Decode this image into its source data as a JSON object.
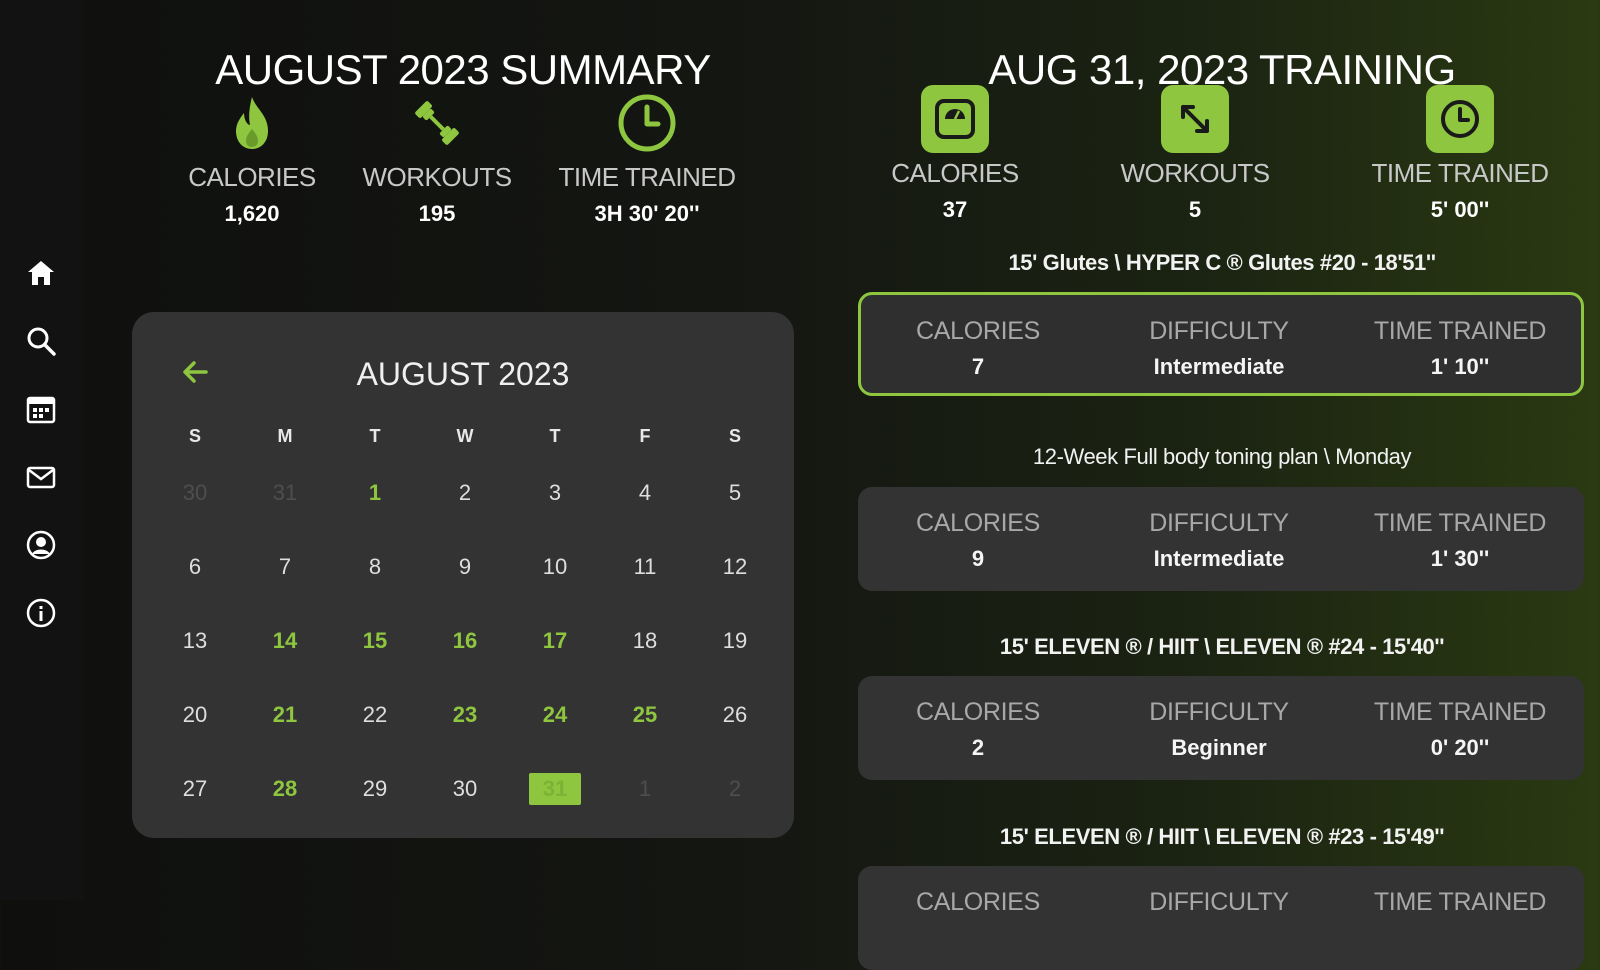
{
  "sidebar": {
    "items": [
      {
        "icon": "home-icon"
      },
      {
        "icon": "search-icon"
      },
      {
        "icon": "calendar-icon"
      },
      {
        "icon": "mail-icon"
      },
      {
        "icon": "profile-icon"
      },
      {
        "icon": "info-icon"
      }
    ]
  },
  "summary": {
    "title": "AUGUST 2023 SUMMARY",
    "stats": [
      {
        "label": "CALORIES",
        "value": "1,620",
        "icon": "flame-icon"
      },
      {
        "label": "WORKOUTS",
        "value": "195",
        "icon": "dumbbell-icon"
      },
      {
        "label": "TIME TRAINED",
        "value": "3H 30' 20''",
        "icon": "clock-icon"
      }
    ]
  },
  "calendar": {
    "month_label": "AUGUST 2023",
    "weekdays": [
      "S",
      "M",
      "T",
      "W",
      "T",
      "F",
      "S"
    ],
    "days": [
      {
        "d": "30",
        "state": "muted"
      },
      {
        "d": "31",
        "state": "muted"
      },
      {
        "d": "1",
        "state": "active"
      },
      {
        "d": "2",
        "state": "normal"
      },
      {
        "d": "3",
        "state": "normal"
      },
      {
        "d": "4",
        "state": "normal"
      },
      {
        "d": "5",
        "state": "normal"
      },
      {
        "d": "6",
        "state": "normal"
      },
      {
        "d": "7",
        "state": "normal"
      },
      {
        "d": "8",
        "state": "normal"
      },
      {
        "d": "9",
        "state": "normal"
      },
      {
        "d": "10",
        "state": "normal"
      },
      {
        "d": "11",
        "state": "normal"
      },
      {
        "d": "12",
        "state": "normal"
      },
      {
        "d": "13",
        "state": "normal"
      },
      {
        "d": "14",
        "state": "active"
      },
      {
        "d": "15",
        "state": "active"
      },
      {
        "d": "16",
        "state": "active"
      },
      {
        "d": "17",
        "state": "active"
      },
      {
        "d": "18",
        "state": "normal"
      },
      {
        "d": "19",
        "state": "normal"
      },
      {
        "d": "20",
        "state": "normal"
      },
      {
        "d": "21",
        "state": "active"
      },
      {
        "d": "22",
        "state": "normal"
      },
      {
        "d": "23",
        "state": "active"
      },
      {
        "d": "24",
        "state": "active"
      },
      {
        "d": "25",
        "state": "active"
      },
      {
        "d": "26",
        "state": "normal"
      },
      {
        "d": "27",
        "state": "normal"
      },
      {
        "d": "28",
        "state": "active"
      },
      {
        "d": "29",
        "state": "normal"
      },
      {
        "d": "30",
        "state": "normal"
      },
      {
        "d": "31",
        "state": "selected"
      },
      {
        "d": "1",
        "state": "muted"
      },
      {
        "d": "2",
        "state": "muted"
      }
    ]
  },
  "training": {
    "title": "AUG 31, 2023 TRAINING",
    "stats": [
      {
        "label": "CALORIES",
        "value": "37",
        "icon": "scale-icon"
      },
      {
        "label": "WORKOUTS",
        "value": "5",
        "icon": "expand-arrows-icon"
      },
      {
        "label": "TIME TRAINED",
        "value": "5' 00''",
        "icon": "clock-icon"
      }
    ],
    "sessions": [
      {
        "title": "15' Glutes \\ HYPER C ® Glutes #20 - 18'51''",
        "calories_label": "CALORIES",
        "calories": "7",
        "difficulty_label": "DIFFICULTY",
        "difficulty": "Intermediate",
        "time_label": "TIME TRAINED",
        "time": "1' 10''",
        "highlighted": true
      },
      {
        "title": "12-Week Full body toning plan \\ Monday",
        "calories_label": "CALORIES",
        "calories": "9",
        "difficulty_label": "DIFFICULTY",
        "difficulty": "Intermediate",
        "time_label": "TIME TRAINED",
        "time": "1' 30''",
        "highlighted": false
      },
      {
        "title": "15' ELEVEN ® / HIIT \\ ELEVEN ® #24 - 15'40''",
        "calories_label": "CALORIES",
        "calories": "2",
        "difficulty_label": "DIFFICULTY",
        "difficulty": "Beginner",
        "time_label": "TIME TRAINED",
        "time": "0' 20''",
        "highlighted": false
      },
      {
        "title": "15' ELEVEN ® / HIIT \\ ELEVEN ® #23 - 15'49''",
        "calories_label": "CALORIES",
        "calories": "",
        "difficulty_label": "DIFFICULTY",
        "difficulty": "",
        "time_label": "TIME TRAINED",
        "time": "",
        "highlighted": false
      }
    ]
  },
  "colors": {
    "accent": "#8ec63f",
    "card": "#333333",
    "muted": "#4e4e4e"
  }
}
